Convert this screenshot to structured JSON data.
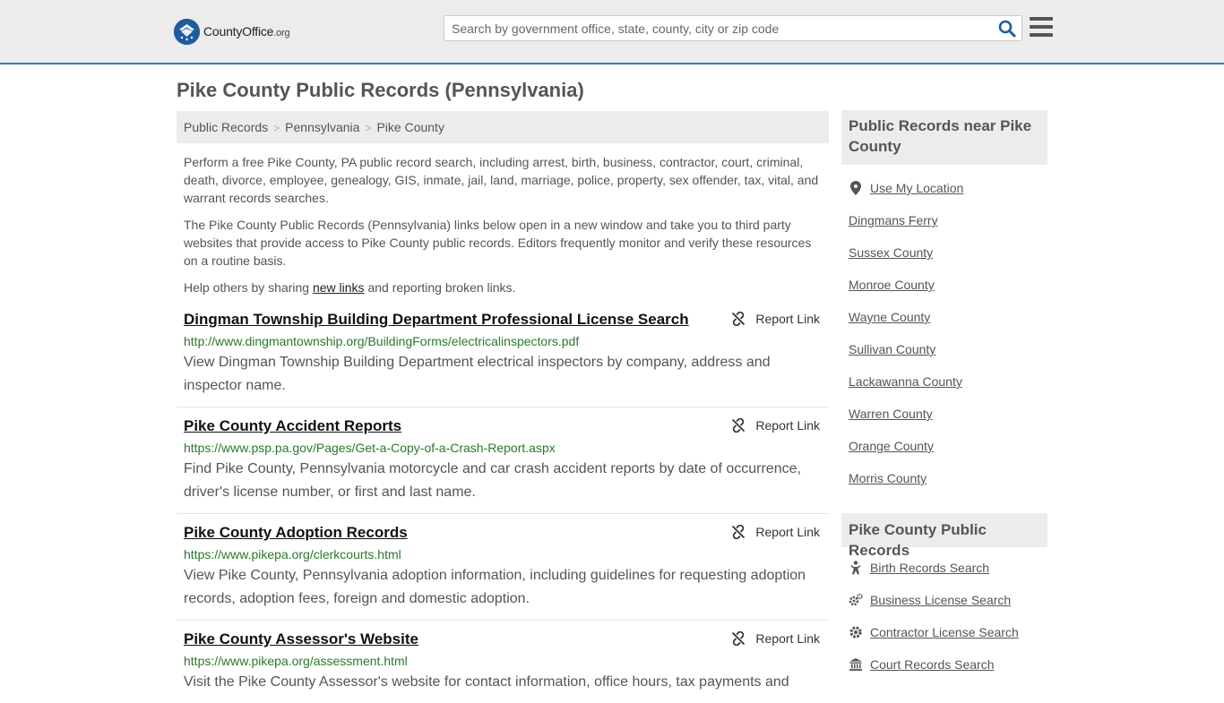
{
  "header": {
    "logo_main": "CountyOffice",
    "logo_suffix": ".org",
    "search_placeholder": "Search by government office, state, county, city or zip code"
  },
  "page_title": "Pike County Public Records (Pennsylvania)",
  "breadcrumb": [
    "Public Records",
    "Pennsylvania",
    "Pike County"
  ],
  "intro": {
    "p1": "Perform a free Pike County, PA public record search, including arrest, birth, business, contractor, court, criminal, death, divorce, employee, genealogy, GIS, inmate, jail, land, marriage, police, property, sex offender, tax, vital, and warrant records searches.",
    "p2": "The Pike County Public Records (Pennsylvania) links below open in a new window and take you to third party websites that provide access to Pike County public records. Editors frequently monitor and verify these resources on a routine basis.",
    "p3_before": "Help others by sharing ",
    "p3_link": "new links",
    "p3_after": " and reporting broken links."
  },
  "report_label": "Report Link",
  "records": [
    {
      "title": "Dingman Township Building Department Professional License Search",
      "url": "http://www.dingmantownship.org/BuildingForms/electricalinspectors.pdf",
      "desc": "View Dingman Township Building Department electrical inspectors by company, address and inspector name."
    },
    {
      "title": "Pike County Accident Reports",
      "url": "https://www.psp.pa.gov/Pages/Get-a-Copy-of-a-Crash-Report.aspx",
      "desc": "Find Pike County, Pennsylvania motorcycle and car crash accident reports by date of occurrence, driver's license number, or first and last name."
    },
    {
      "title": "Pike County Adoption Records",
      "url": "https://www.pikepa.org/clerkcourts.html",
      "desc": "View Pike County, Pennsylvania adoption information, including guidelines for requesting adoption records, adoption fees, foreign and domestic adoption."
    },
    {
      "title": "Pike County Assessor's Website",
      "url": "https://www.pikepa.org/assessment.html",
      "desc": "Visit the Pike County Assessor's website for contact information, office hours, tax payments and"
    }
  ],
  "sidebar": {
    "near_heading": "Public Records near Pike County",
    "use_location": "Use My Location",
    "near_items": [
      "Dingmans Ferry",
      "Sussex County",
      "Monroe County",
      "Wayne County",
      "Sullivan County",
      "Lackawanna County",
      "Warren County",
      "Orange County",
      "Morris County"
    ],
    "records_heading": "Pike County Public Records",
    "record_items": [
      {
        "label": "Birth Records Search",
        "icon": "baby-icon"
      },
      {
        "label": "Business License Search",
        "icon": "gears-icon"
      },
      {
        "label": "Contractor License Search",
        "icon": "gear-icon"
      },
      {
        "label": "Court Records Search",
        "icon": "courthouse-icon"
      }
    ]
  },
  "colors": {
    "accent": "#3c7bbf",
    "link_green": "#2a7a2a",
    "header_bg": "#ececec"
  }
}
